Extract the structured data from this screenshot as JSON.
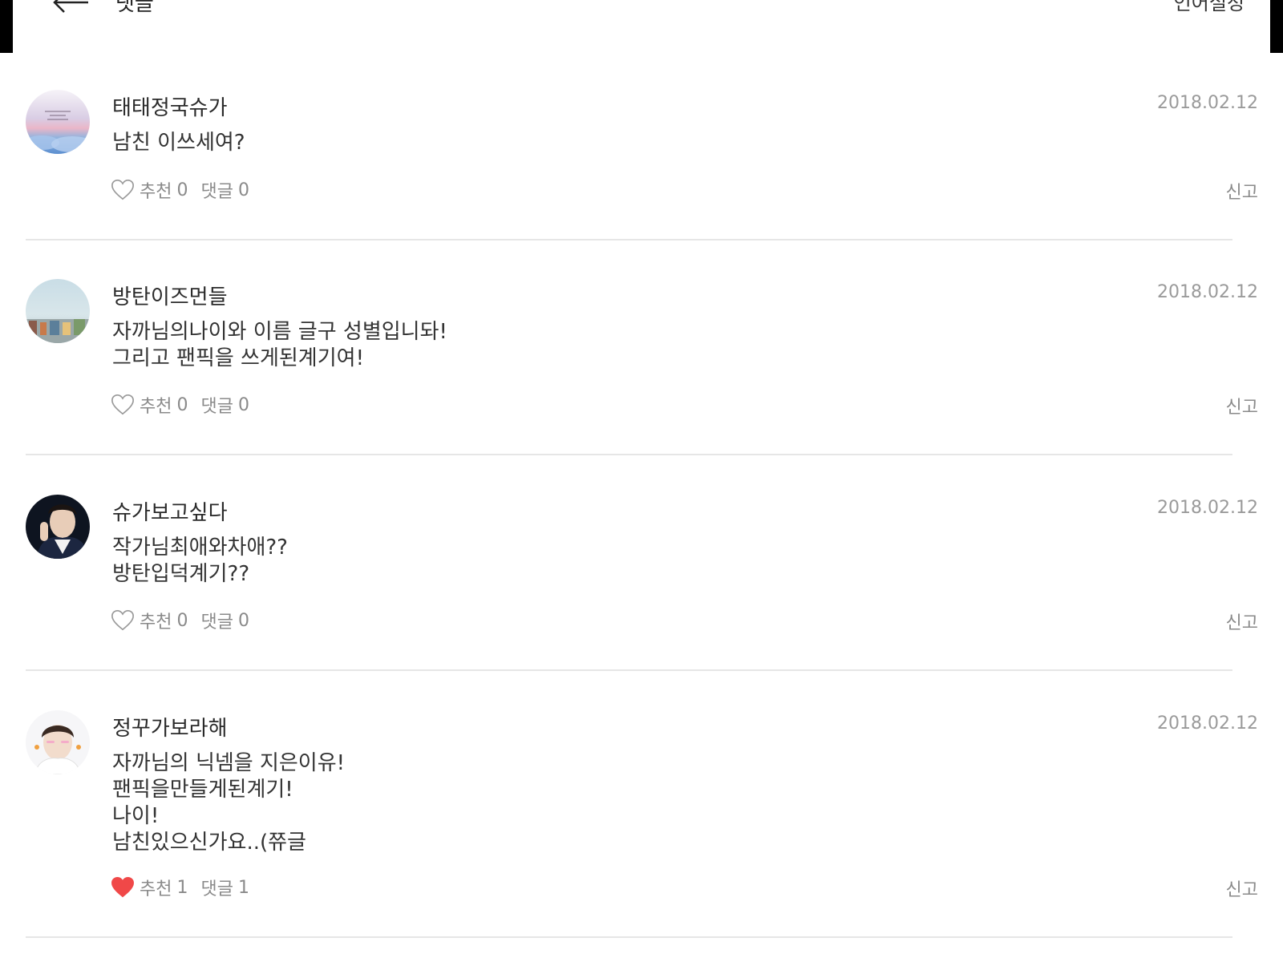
{
  "header": {
    "title": "댓글",
    "language_setting": "언어설정"
  },
  "comments": [
    {
      "username": "태태정국슈가",
      "date": "2018.02.12",
      "lines": [
        "남친 이쓰세여?"
      ],
      "like_label": "추천",
      "like_count": "0",
      "reply_label": "댓글",
      "reply_count": "0",
      "liked": false,
      "report": "신고"
    },
    {
      "username": "방탄이즈먼들",
      "date": "2018.02.12",
      "lines": [
        "자까님의나이와 이름 글구 성별입니돠!",
        "그리고 팬픽을 쓰게된계기여!"
      ],
      "like_label": "추천",
      "like_count": "0",
      "reply_label": "댓글",
      "reply_count": "0",
      "liked": false,
      "report": "신고"
    },
    {
      "username": "슈가보고싶다",
      "date": "2018.02.12",
      "lines": [
        "작가님최애와차애??",
        "방탄입덕계기??"
      ],
      "like_label": "추천",
      "like_count": "0",
      "reply_label": "댓글",
      "reply_count": "0",
      "liked": false,
      "report": "신고"
    },
    {
      "username": "정꾸가보라해",
      "date": "2018.02.12",
      "lines": [
        "자까님의 닉넴을 지은이유!",
        "팬픽을만들게된계기!",
        "나이!",
        "남친있으신가요..(쮸글"
      ],
      "like_label": "추천",
      "like_count": "1",
      "reply_label": "댓글",
      "reply_count": "1",
      "liked": true,
      "report": "신고"
    }
  ],
  "colors": {
    "heart_liked": "#f04848",
    "heart_outline": "#9a9a9a",
    "divider": "#e6e6e6"
  }
}
